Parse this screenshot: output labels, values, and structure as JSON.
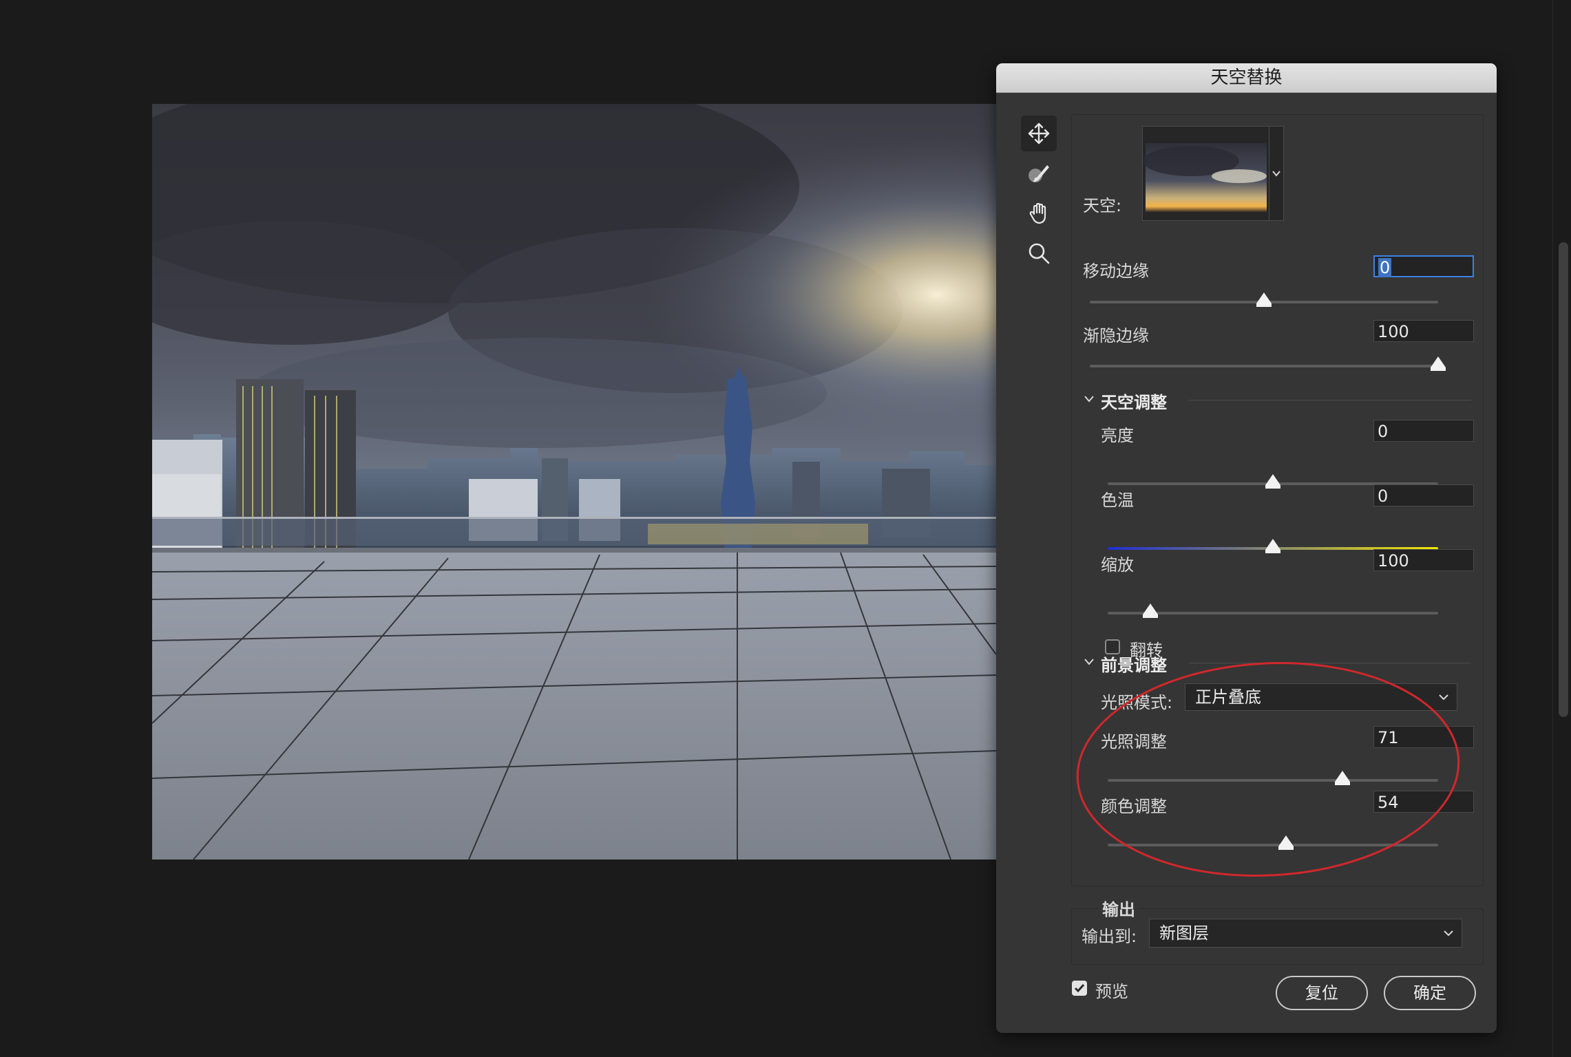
{
  "dialog": {
    "title": "天空替换",
    "sky_label": "天空:",
    "move_edge": {
      "label": "移动边缘",
      "value": "0"
    },
    "fade_edge": {
      "label": "渐隐边缘",
      "value": "100"
    },
    "sky_adjust": {
      "heading": "天空调整",
      "brightness": {
        "label": "亮度",
        "value": "0"
      },
      "temperature": {
        "label": "色温",
        "value": "0"
      },
      "scale": {
        "label": "缩放",
        "value": "100"
      },
      "flip": {
        "label": "翻转",
        "checked": false
      }
    },
    "foreground_adjust": {
      "heading": "前景调整",
      "lighting_mode": {
        "label": "光照模式:",
        "value": "正片叠底"
      },
      "lighting_adjust": {
        "label": "光照调整",
        "value": "71"
      },
      "color_adjust": {
        "label": "颜色调整",
        "value": "54"
      }
    },
    "output": {
      "heading": "输出",
      "output_to_label": "输出到:",
      "output_to_value": "新图层"
    },
    "preview": {
      "label": "预览",
      "checked": true
    },
    "reset_button": "复位",
    "ok_button": "确定"
  },
  "tools": [
    "move-tool-icon",
    "sky-brush-icon",
    "hand-icon",
    "zoom-icon"
  ],
  "slider_levels": {
    "move_edge": 0.5,
    "fade_edge": 1.0,
    "brightness": 0.5,
    "temperature": 0.5,
    "scale": 0.13,
    "lighting_adjust": 0.71,
    "color_adjust": 0.54
  },
  "colors": {
    "focus": "#3a82e6",
    "annotation": "#d0282c",
    "temp_cold": "#1f2fd6",
    "temp_warm": "#f2e600"
  }
}
